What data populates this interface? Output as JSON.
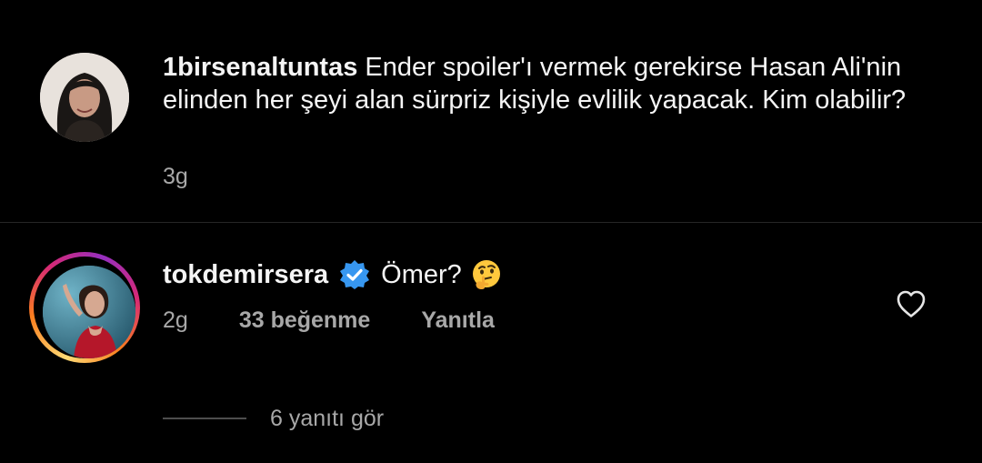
{
  "post": {
    "username": "1birsenaltuntas",
    "text": "Ender spoiler'ı vermek gerekirse Hasan Ali'nin elinden her şeyi alan sürpriz kişiyle evlilik yapacak. Kim olabilir?",
    "time": "3g"
  },
  "comment": {
    "username": "tokdemirsera",
    "verified_icon": "verified-badge-icon",
    "text": "Ömer?",
    "emoji": "thinking-face-emoji",
    "time": "2g",
    "likes_label": "33 beğenme",
    "reply_label": "Yanıtla",
    "like_icon": "heart-outline-icon"
  },
  "replies": {
    "label": "6 yanıtı gör"
  },
  "colors": {
    "background": "#000000",
    "text": "#f5f5f5",
    "secondary_text": "#a8a8a8",
    "verified_blue": "#3797f0",
    "divider": "#262626"
  }
}
